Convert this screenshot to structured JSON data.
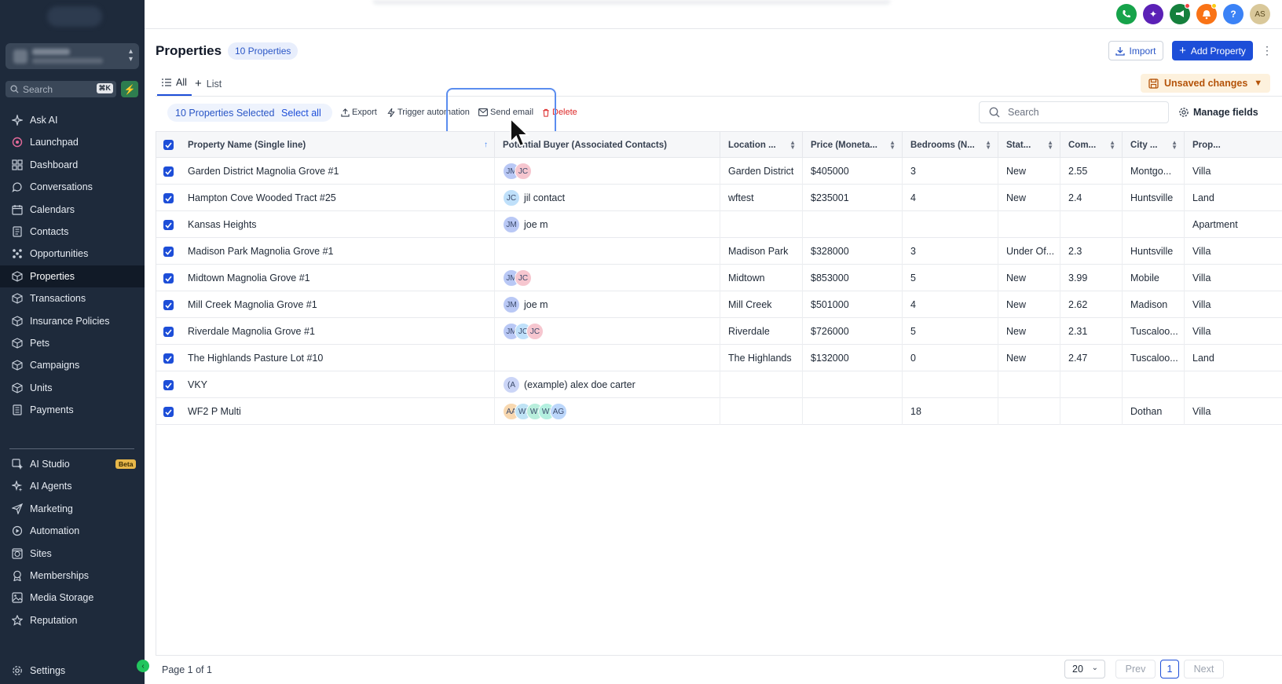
{
  "sidebar": {
    "search_placeholder": "Search",
    "search_shortcut": "⌘K",
    "items": [
      {
        "label": "Ask AI",
        "icon": "sparkles-icon"
      },
      {
        "label": "Launchpad",
        "icon": "rocket-icon"
      },
      {
        "label": "Dashboard",
        "icon": "dashboard-icon"
      },
      {
        "label": "Conversations",
        "icon": "chat-icon"
      },
      {
        "label": "Calendars",
        "icon": "calendar-icon"
      },
      {
        "label": "Contacts",
        "icon": "contacts-icon"
      },
      {
        "label": "Opportunities",
        "icon": "opportunities-icon"
      },
      {
        "label": "Properties",
        "icon": "cube-icon"
      },
      {
        "label": "Transactions",
        "icon": "cube-icon"
      },
      {
        "label": "Insurance Policies",
        "icon": "cube-icon"
      },
      {
        "label": "Pets",
        "icon": "cube-icon"
      },
      {
        "label": "Campaigns",
        "icon": "cube-icon"
      },
      {
        "label": "Units",
        "icon": "cube-icon"
      },
      {
        "label": "Payments",
        "icon": "payments-icon"
      }
    ],
    "items2": [
      {
        "label": "AI Studio",
        "icon": "ai-studio-icon",
        "badge": "Beta"
      },
      {
        "label": "AI Agents",
        "icon": "ai-agents-icon"
      },
      {
        "label": "Marketing",
        "icon": "send-icon"
      },
      {
        "label": "Automation",
        "icon": "automation-icon"
      },
      {
        "label": "Sites",
        "icon": "sites-icon"
      },
      {
        "label": "Memberships",
        "icon": "membership-icon"
      },
      {
        "label": "Media Storage",
        "icon": "image-icon"
      },
      {
        "label": "Reputation",
        "icon": "star-icon"
      }
    ],
    "settings": "Settings"
  },
  "topbar": {
    "avatar": "AS",
    "help": "?"
  },
  "header": {
    "title": "Properties",
    "count": "10 Properties",
    "import": "Import",
    "add": "Add Property",
    "tab_all": "All",
    "tab_list": "List",
    "unsaved": "Unsaved changes"
  },
  "bulk": {
    "selected": "10 Properties Selected",
    "select_all": "Select all",
    "export": "Export",
    "trigger": "Trigger automation",
    "send_email": "Send email",
    "delete": "Delete"
  },
  "toolbar": {
    "search_placeholder": "Search",
    "manage_fields": "Manage fields"
  },
  "table": {
    "columns": [
      "Property Name (Single line)",
      "Potential Buyer (Associated Contacts)",
      "Location ...",
      "Price (Moneta...",
      "Bedrooms (N...",
      "Stat...",
      "Com...",
      "City ...",
      "Prop..."
    ],
    "rows": [
      {
        "name": "Garden District Magnolia Grove #1",
        "avatars": [
          "JM",
          "JC"
        ],
        "buyer": "",
        "location": "Garden District",
        "price": "$405000",
        "bedrooms": "3",
        "status": "New",
        "com": "2.55",
        "city": "Montgo...",
        "prop": "Villa"
      },
      {
        "name": "Hampton Cove Wooded Tract #25",
        "avatars": [
          "JC"
        ],
        "buyer": "jil contact",
        "location": "wftest",
        "price": "$235001",
        "bedrooms": "4",
        "status": "New",
        "com": "2.4",
        "city": "Huntsville",
        "prop": "Land"
      },
      {
        "name": "Kansas Heights",
        "avatars": [
          "JM"
        ],
        "buyer": "joe m",
        "location": "",
        "price": "",
        "bedrooms": "",
        "status": "",
        "com": "",
        "city": "",
        "prop": "Apartment"
      },
      {
        "name": "Madison Park Magnolia Grove #1",
        "avatars": [],
        "buyer": "",
        "location": "Madison Park",
        "price": "$328000",
        "bedrooms": "3",
        "status": "Under Of...",
        "com": "2.3",
        "city": "Huntsville",
        "prop": "Villa"
      },
      {
        "name": "Midtown Magnolia Grove #1",
        "avatars": [
          "JM",
          "JC"
        ],
        "buyer": "",
        "location": "Midtown",
        "price": "$853000",
        "bedrooms": "5",
        "status": "New",
        "com": "3.99",
        "city": "Mobile",
        "prop": "Villa"
      },
      {
        "name": "Mill Creek Magnolia Grove #1",
        "avatars": [
          "JM"
        ],
        "buyer": "joe m",
        "location": "Mill Creek",
        "price": "$501000",
        "bedrooms": "4",
        "status": "New",
        "com": "2.62",
        "city": "Madison",
        "prop": "Villa"
      },
      {
        "name": "Riverdale Magnolia Grove #1",
        "avatars": [
          "JM",
          "JC",
          "JC"
        ],
        "buyer": "",
        "location": "Riverdale",
        "price": "$726000",
        "bedrooms": "5",
        "status": "New",
        "com": "2.31",
        "city": "Tuscaloo...",
        "prop": "Villa"
      },
      {
        "name": "The Highlands Pasture Lot #10",
        "avatars": [],
        "buyer": "",
        "location": "The Highlands",
        "price": "$132000",
        "bedrooms": "0",
        "status": "New",
        "com": "2.47",
        "city": "Tuscaloo...",
        "prop": "Land"
      },
      {
        "name": "VKY",
        "avatars": [
          "(A"
        ],
        "buyer": "(example) alex doe carter",
        "location": "",
        "price": "",
        "bedrooms": "",
        "status": "",
        "com": "",
        "city": "",
        "prop": ""
      },
      {
        "name": "WF2 P Multi",
        "avatars": [
          "AA",
          "WI",
          "WI",
          "WI",
          "AG"
        ],
        "buyer": "",
        "location": "",
        "price": "",
        "bedrooms": "18",
        "status": "",
        "com": "",
        "city": "Dothan",
        "prop": "Villa"
      }
    ]
  },
  "footer": {
    "page_info": "Page 1 of 1",
    "per_page": "20",
    "prev": "Prev",
    "current": "1",
    "next": "Next"
  },
  "colors": {
    "primary": "#1d4ed8",
    "sidebar": "#1e2a3b",
    "danger": "#dc2626",
    "warning": "#b45309"
  }
}
